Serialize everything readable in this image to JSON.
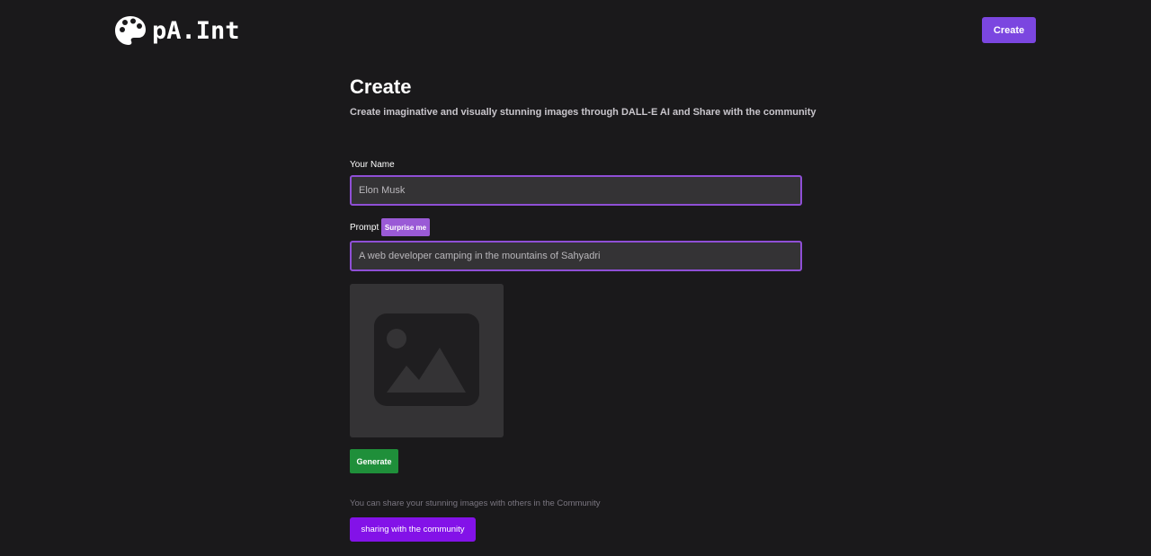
{
  "header": {
    "logo_text": "pA.Int",
    "logo_icon": "palette-icon",
    "create_label": "Create"
  },
  "page": {
    "title": "Create",
    "subtitle": "Create imaginative and visually stunning images through DALL-E AI and Share with the community"
  },
  "form": {
    "name_label": "Your Name",
    "name_value": "Elon Musk",
    "prompt_label": "Prompt",
    "surprise_label": "Surprise me",
    "prompt_value": "A web developer camping in the mountains of Sahyadri",
    "preview_icon": "image-placeholder-icon",
    "generate_label": "Generate"
  },
  "share": {
    "note": "You can share your stunning images with others in the Community",
    "button_label": "sharing with the community"
  },
  "colors": {
    "background": "#1a191b",
    "accent": "#7b46e0",
    "input_border": "#8f4fd6",
    "generate": "#1f8f3a",
    "share": "#8312e8"
  }
}
